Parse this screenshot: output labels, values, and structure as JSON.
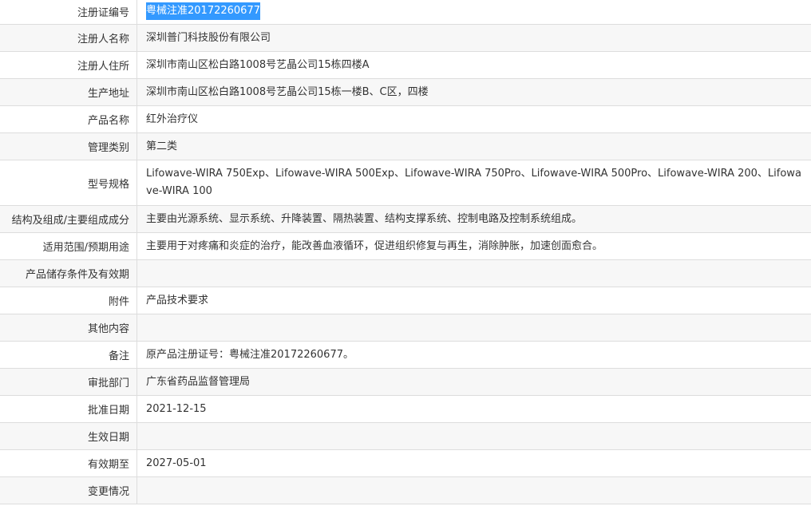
{
  "rows": [
    {
      "label": "注册证编号",
      "value": "粤械注准20172260677",
      "height": 33,
      "selected": true
    },
    {
      "label": "注册人名称",
      "value": "深圳普门科技股份有限公司",
      "height": 34
    },
    {
      "label": "注册人住所",
      "value": "深圳市南山区松白路1008号艺晶公司15栋四楼A",
      "height": 34
    },
    {
      "label": "生产地址",
      "value": "深圳市南山区松白路1008号艺晶公司15栋一楼B、C区，四楼",
      "height": 34
    },
    {
      "label": "产品名称",
      "value": "红外治疗仪",
      "height": 34
    },
    {
      "label": "管理类别",
      "value": "第二类",
      "height": 34
    },
    {
      "label": "型号规格",
      "value": "Lifowave-WIRA 750Exp、Lifowave-WIRA 500Exp、Lifowave-WIRA 750Pro、Lifowave-WIRA 500Pro、Lifowave-WIRA 200、Lifowave-WIRA 100",
      "height": 57
    },
    {
      "label": "结构及组成/主要组成成分",
      "value": "主要由光源系统、显示系统、升降装置、隔热装置、结构支撑系统、控制电路及控制系统组成。",
      "height": 34
    },
    {
      "label": "适用范围/预期用途",
      "value": "主要用于对疼痛和炎症的治疗，能改善血液循环，促进组织修复与再生，消除肿胀，加速创面愈合。",
      "height": 34
    },
    {
      "label": "产品储存条件及有效期",
      "value": "",
      "height": 34
    },
    {
      "label": "附件",
      "value": "产品技术要求",
      "height": 34
    },
    {
      "label": "其他内容",
      "value": "",
      "height": 34
    },
    {
      "label": "备注",
      "value": "原产品注册证号：粤械注准20172260677。",
      "height": 34
    },
    {
      "label": "审批部门",
      "value": "广东省药品监督管理局",
      "height": 34
    },
    {
      "label": "批准日期",
      "value": "2021-12-15",
      "height": 34
    },
    {
      "label": "生效日期",
      "value": "",
      "height": 34
    },
    {
      "label": "有效期至",
      "value": "2027-05-01",
      "height": 34
    },
    {
      "label": "变更情况",
      "value": "",
      "height": 34
    }
  ],
  "colors": {
    "border": "#dddddd",
    "alt_row": "#f7f7f7",
    "text": "#333333",
    "selection": "#3399ff"
  }
}
